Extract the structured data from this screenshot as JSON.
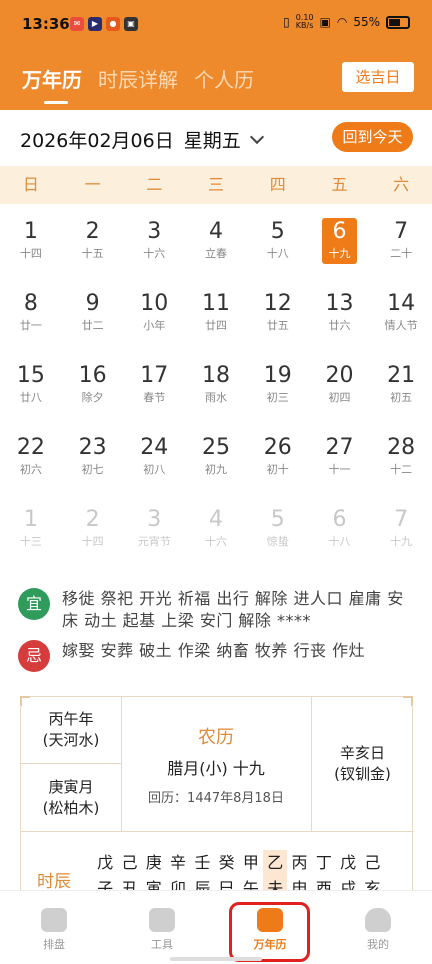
{
  "status": {
    "time": "13:36",
    "net_speed": "0.10",
    "net_unit": "KB/s",
    "battery": "55%"
  },
  "header": {
    "tabs": [
      {
        "label": "万年历"
      },
      {
        "label": "时辰详解"
      },
      {
        "label": "个人历"
      }
    ],
    "pick_day": "选吉日"
  },
  "datebar": {
    "date": "2026年02月06日",
    "weekday": "星期五",
    "back_today": "回到今天"
  },
  "weekdays": [
    "日",
    "一",
    "二",
    "三",
    "四",
    "五",
    "六"
  ],
  "calendar": [
    [
      {
        "d": "1",
        "l": "十四"
      },
      {
        "d": "2",
        "l": "十五"
      },
      {
        "d": "3",
        "l": "十六"
      },
      {
        "d": "4",
        "l": "立春"
      },
      {
        "d": "5",
        "l": "十八"
      },
      {
        "d": "6",
        "l": "十九",
        "sel": true
      },
      {
        "d": "7",
        "l": "二十"
      }
    ],
    [
      {
        "d": "8",
        "l": "廿一"
      },
      {
        "d": "9",
        "l": "廿二"
      },
      {
        "d": "10",
        "l": "小年"
      },
      {
        "d": "11",
        "l": "廿四"
      },
      {
        "d": "12",
        "l": "廿五"
      },
      {
        "d": "13",
        "l": "廿六"
      },
      {
        "d": "14",
        "l": "情人节"
      }
    ],
    [
      {
        "d": "15",
        "l": "廿八"
      },
      {
        "d": "16",
        "l": "除夕"
      },
      {
        "d": "17",
        "l": "春节"
      },
      {
        "d": "18",
        "l": "雨水"
      },
      {
        "d": "19",
        "l": "初三"
      },
      {
        "d": "20",
        "l": "初四"
      },
      {
        "d": "21",
        "l": "初五"
      }
    ],
    [
      {
        "d": "22",
        "l": "初六"
      },
      {
        "d": "23",
        "l": "初七"
      },
      {
        "d": "24",
        "l": "初八"
      },
      {
        "d": "25",
        "l": "初九"
      },
      {
        "d": "26",
        "l": "初十"
      },
      {
        "d": "27",
        "l": "十一"
      },
      {
        "d": "28",
        "l": "十二"
      }
    ],
    [
      {
        "d": "1",
        "l": "十三",
        "dim": true
      },
      {
        "d": "2",
        "l": "十四",
        "dim": true
      },
      {
        "d": "3",
        "l": "元宵节",
        "dim": true
      },
      {
        "d": "4",
        "l": "十六",
        "dim": true
      },
      {
        "d": "5",
        "l": "惊蛰",
        "dim": true
      },
      {
        "d": "6",
        "l": "十八",
        "dim": true
      },
      {
        "d": "7",
        "l": "十九",
        "dim": true
      }
    ]
  ],
  "yi": {
    "label": "宜",
    "text": "移徙 祭祀 开光 祈福 出行 解除 进人口 雇庸 安床 动土 起基 上梁 安门 解除 ****"
  },
  "ji": {
    "label": "忌",
    "text": "嫁娶 安葬 破土 作梁 纳畜 牧养 行丧 作灶"
  },
  "info": {
    "year": "丙午年",
    "year_el": "(天河水)",
    "month": "庚寅月",
    "month_el": "(松柏木)",
    "nongli_title": "农历",
    "nongli_date": "腊月(小) 十九",
    "huili": "回历：1447年8月18日",
    "day": "辛亥日",
    "day_el": "(钗钏金)",
    "shichen_label": "时辰",
    "stems": [
      "戊",
      "己",
      "庚",
      "辛",
      "壬",
      "癸",
      "甲",
      "乙",
      "丙",
      "丁",
      "戊",
      "己"
    ],
    "branches": [
      "子",
      "丑",
      "寅",
      "卯",
      "辰",
      "巳",
      "午",
      "未",
      "申",
      "酉",
      "戌",
      "亥"
    ]
  },
  "nav": [
    {
      "label": "排盘",
      "icon": "chart-board-icon"
    },
    {
      "label": "工具",
      "icon": "toolbox-icon"
    },
    {
      "label": "万年历",
      "icon": "calendar-icon"
    },
    {
      "label": "我的",
      "icon": "person-icon"
    }
  ],
  "colors": {
    "accent": "#ee7b18",
    "header": "#ee8a2c",
    "yi": "#2f9c5b",
    "ji": "#d73c3c"
  }
}
